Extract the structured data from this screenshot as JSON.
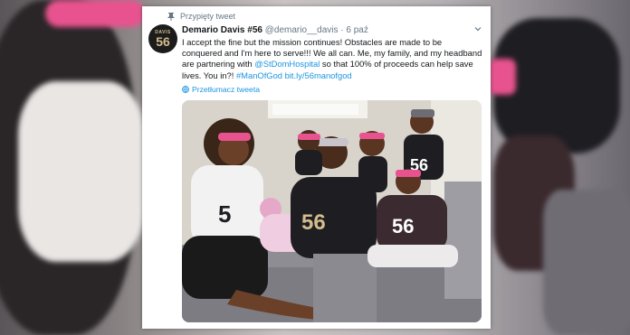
{
  "pinned_label": "Przypięty tweet",
  "author": {
    "name": "Demario Davis #56",
    "handle": "@demario__davis",
    "separator": "·",
    "time": "6 paź",
    "avatar_top": "DAVIS",
    "avatar_number": "56"
  },
  "tweet": {
    "text_1": "I accept the fine but the mission continues! Obstacles are made to be conquered and I'm here to serve!!! We all can. Me, my family, and my headband are partnering with ",
    "mention": "@StDomHospital",
    "text_2": " so that 100% of proceeds can help save lives. You in?! ",
    "hashtag": "#ManOfGod",
    "space": " ",
    "url": "bit.ly/56manofgod"
  },
  "translate_label": "Przetłumacz tweeta",
  "colors": {
    "link": "#1b95e0",
    "pink": "#e8538f",
    "jersey_black": "#1e1e22"
  }
}
